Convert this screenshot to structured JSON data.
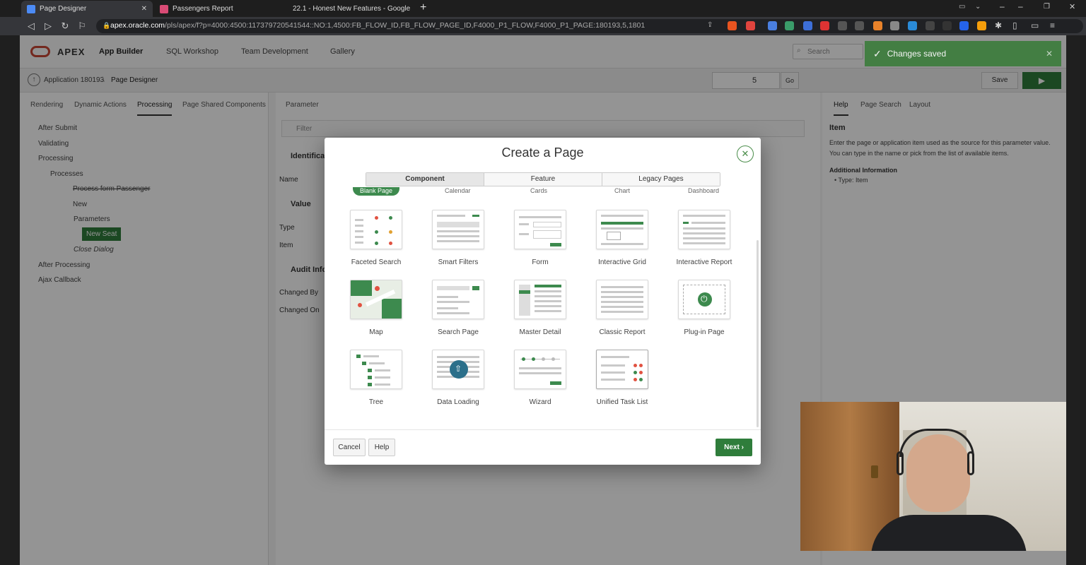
{
  "browser": {
    "tabs": [
      {
        "title": "Page Designer",
        "active": true,
        "color": "#4c8bf5"
      },
      {
        "title": "Passengers Report",
        "active": false,
        "color": "#d94b75"
      },
      {
        "title": "22.1 - Honest New Features - Google",
        "active": false,
        "color": "#f4b400"
      }
    ],
    "new_tab": "+",
    "url_host": "apex.oracle.com",
    "url_rest": "/pls/apex/f?p=4000:4500:117379720541544::NO:1,4500:FB_FLOW_ID,FB_FLOW_PAGE_ID,F4000_P1_FLOW,F4000_P1_PAGE:180193,5,180193,5#"
  },
  "apex": {
    "logo": "APEX",
    "nav": [
      "App Builder",
      "SQL Workshop",
      "Team Development",
      "Gallery"
    ],
    "search_placeholder": "Search",
    "toast": "Changes saved",
    "breadcrumb": [
      "Application 180193",
      "Page Designer"
    ],
    "page_number": "5",
    "go_label": "Go",
    "save_label": "Save",
    "left_tabs": [
      "Rendering",
      "Dynamic Actions",
      "Processing",
      "Page Shared Components"
    ],
    "tree": [
      "After Submit",
      "Validating",
      "Processing",
      "Processes",
      "Process form Passenger",
      "New",
      "Parameters",
      "New Seat",
      "Close Dialog",
      "After Processing",
      "Ajax Callback"
    ],
    "middle_tab": "Parameter",
    "filter_placeholder": "Filter",
    "mid_sections": [
      "Identifica",
      "Value",
      "Audit Info"
    ],
    "mid_labels": [
      "Name",
      "Type",
      "Item",
      "Changed By",
      "Changed On"
    ],
    "right_tabs": [
      "Help",
      "Page Search",
      "Layout"
    ],
    "help_title": "Item",
    "help_text": "Enter the page or application item used as the source for this parameter value. You can type in the name or pick from the list of available items.",
    "help_sub": "Additional Information",
    "help_bullet": "Type: Item"
  },
  "dialog": {
    "title": "Create a Page",
    "tabs": [
      "Component",
      "Feature",
      "Legacy Pages"
    ],
    "partial_row": [
      "Blank Page",
      "Calendar",
      "Cards",
      "Chart",
      "Dashboard"
    ],
    "cards": [
      "Faceted Search",
      "Smart Filters",
      "Form",
      "Interactive Grid",
      "Interactive Report",
      "Map",
      "Search Page",
      "Master Detail",
      "Classic Report",
      "Plug-in Page",
      "Tree",
      "Data Loading",
      "Wizard",
      "Unified Task List"
    ],
    "cancel": "Cancel",
    "help": "Help",
    "next": "Next"
  },
  "colors": {
    "accent": "#2f7d3b",
    "toast": "#3b7d3b",
    "apex_red": "#c74634"
  }
}
